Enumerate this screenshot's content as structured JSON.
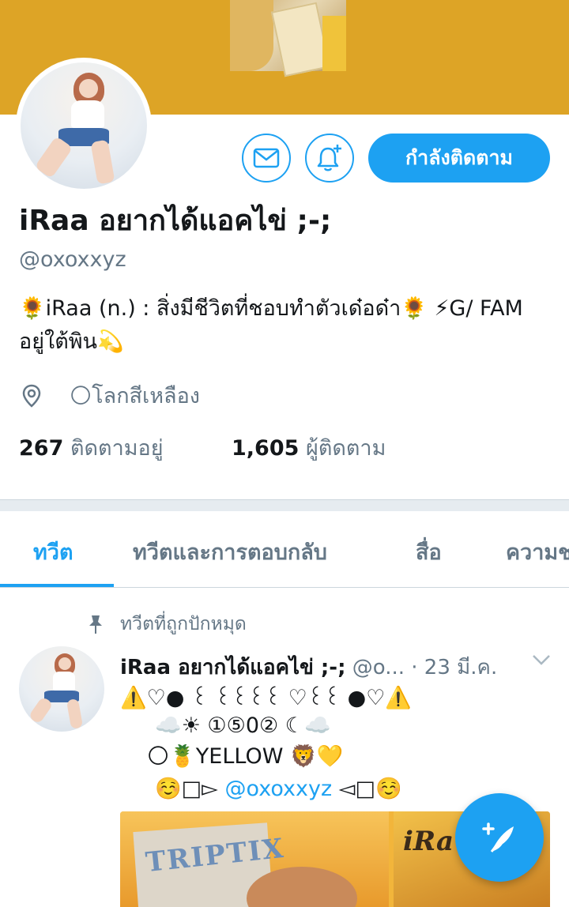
{
  "profile": {
    "display_name": "iRaa อยากได้แอคไข่ ;-;",
    "handle": "@oxoxxyz",
    "bio": "🌻iRaa (n.) : สิ่งมีชีวิตที่ชอบทำตัวเด๋อด๋า🌻 ⚡G/ FAM อยู่ใต้พิน💫",
    "location": "🌕โลกสีเหลือง",
    "following_count": "267",
    "following_label": "ติดตามอยู่",
    "followers_count": "1,605",
    "followers_label": "ผู้ติดตาม"
  },
  "actions": {
    "follow_label": "กำลังติดตาม"
  },
  "tabs": [
    {
      "label": "ทวีต"
    },
    {
      "label": "ทวีตและการตอบกลับ"
    },
    {
      "label": "สื่อ"
    },
    {
      "label": "ความช"
    }
  ],
  "pinned_tweet": {
    "pinned_label": "ทวีตที่ถูกปักหมุด",
    "author_name": "iRaa อยากได้แอคไข่ ;-;",
    "author_handle": "@o...",
    "date": "· 23 มี.ค.",
    "lines": [
      "⚠️♡● ꒰ ꒰꒰꒰꒰ ♡꒰꒰ ●♡⚠️",
      "☁️☀ ①⑤0② ☾☁️",
      "🌕🍍YELLOW 🦁💛",
      "☺️□▻"
    ],
    "mention": "@oxoxxyz",
    "line4_end": "◅□☺️",
    "media_left_text": "TRIPTIX",
    "media_right_text": "iRa"
  },
  "colors": {
    "accent": "#1da1f2",
    "banner": "#dda426",
    "secondary_text": "#657786"
  },
  "icons": {
    "message": "mail-icon",
    "notify": "bell-plus-icon",
    "location": "location-pin-icon",
    "pinned": "pushpin-icon",
    "more": "chevron-down-icon",
    "compose": "compose-feather-icon"
  }
}
